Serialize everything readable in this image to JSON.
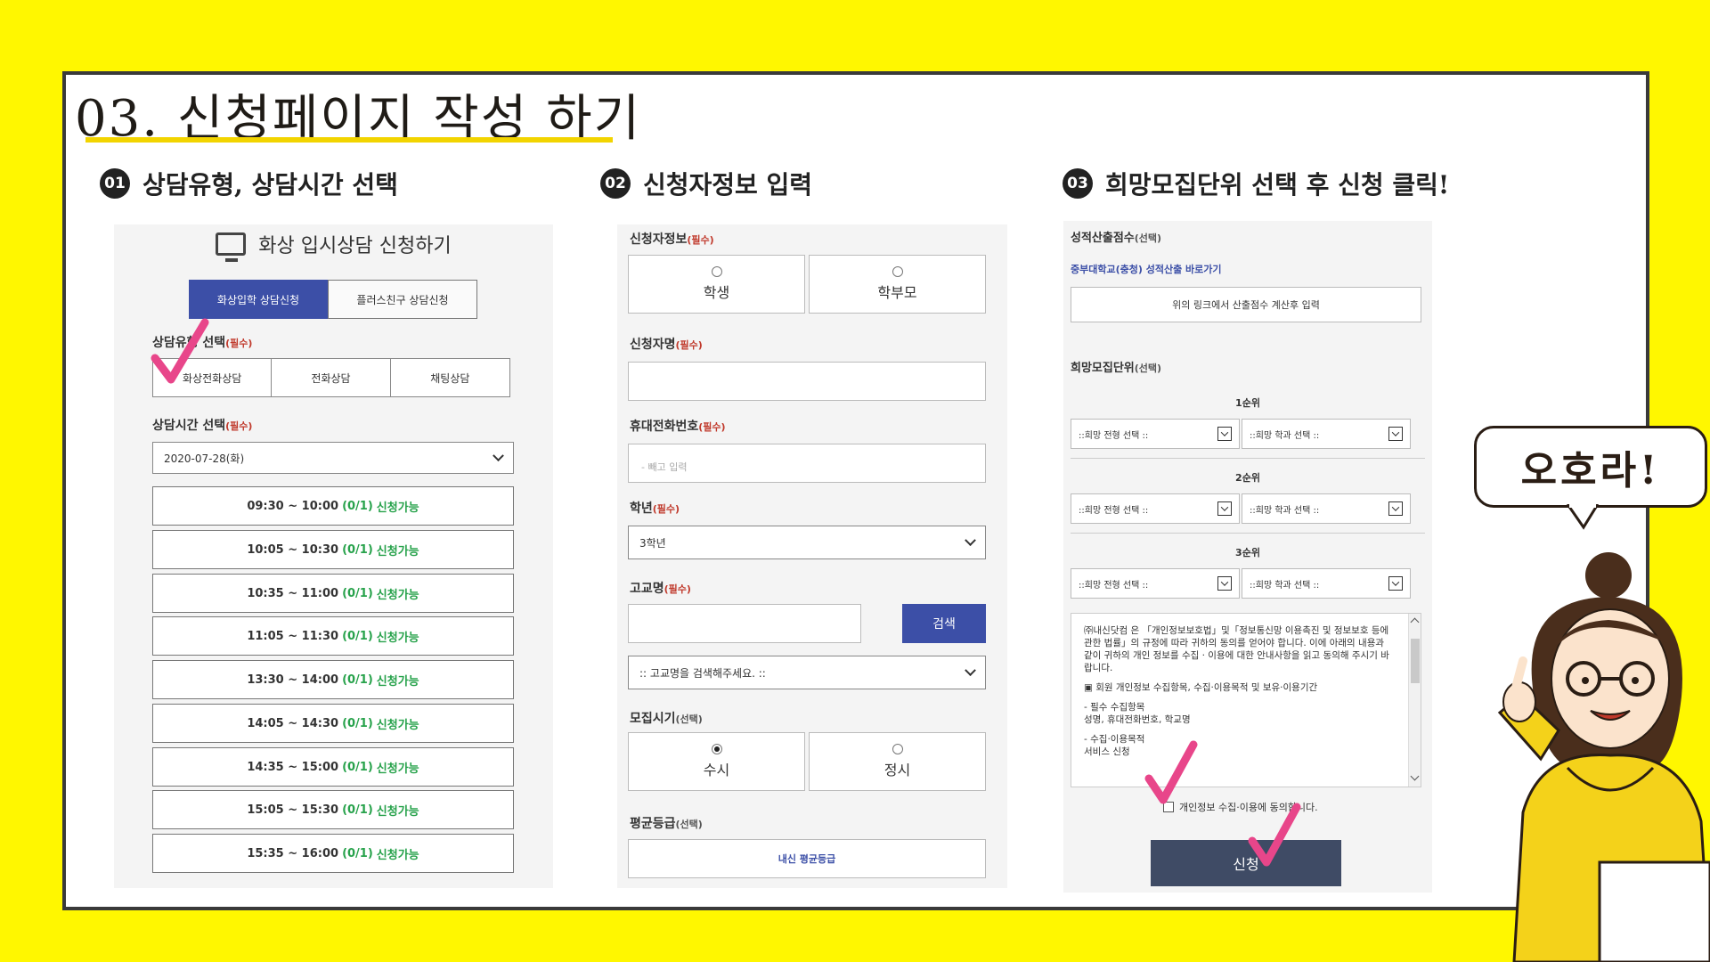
{
  "title": "03. 신청페이지 작성 하기",
  "steps": [
    {
      "num": "01",
      "label": "상담유형, 상담시간 선택"
    },
    {
      "num": "02",
      "label": "신청자정보 입력"
    },
    {
      "num": "03",
      "label": "희망모집단위 선택 후 신청 클릭!"
    }
  ],
  "panel1": {
    "header": "화상 입시상담 신청하기",
    "tabs": [
      "화상입학 상담신청",
      "플러스친구 상담신청"
    ],
    "type_label": "상담유형 선택",
    "required": "(필수)",
    "types": [
      "화상전화상담",
      "전화상담",
      "채팅상담"
    ],
    "time_label": "상담시간 선택",
    "date": "2020-07-28(화)",
    "slots": [
      {
        "time": "09:30 ~ 10:00",
        "count": "(0/1)",
        "status": "신청가능"
      },
      {
        "time": "10:05 ~ 10:30",
        "count": "(0/1)",
        "status": "신청가능"
      },
      {
        "time": "10:35 ~ 11:00",
        "count": "(0/1)",
        "status": "신청가능"
      },
      {
        "time": "11:05 ~ 11:30",
        "count": "(0/1)",
        "status": "신청가능"
      },
      {
        "time": "13:30 ~ 14:00",
        "count": "(0/1)",
        "status": "신청가능"
      },
      {
        "time": "14:05 ~ 14:30",
        "count": "(0/1)",
        "status": "신청가능"
      },
      {
        "time": "14:35 ~ 15:00",
        "count": "(0/1)",
        "status": "신청가능"
      },
      {
        "time": "15:05 ~ 15:30",
        "count": "(0/1)",
        "status": "신청가능"
      },
      {
        "time": "15:35 ~ 16:00",
        "count": "(0/1)",
        "status": "신청가능"
      }
    ]
  },
  "panel2": {
    "applicant_label": "신청자정보",
    "required": "(필수)",
    "optional": "(선택)",
    "applicant_options": [
      "학생",
      "학부모"
    ],
    "name_label": "신청자명",
    "phone_label": "휴대전화번호",
    "phone_placeholder": "- 빼고 입력",
    "grade_label": "학년",
    "grade_value": "3학년",
    "school_label": "고교명",
    "search_button": "검색",
    "school_select": ":: 고교명을 검색해주세요. ::",
    "period_label": "모집시기",
    "period_options": [
      "수시",
      "정시"
    ],
    "average_label": "평균등급",
    "average_button": "내신 평균등급"
  },
  "panel3": {
    "score_label": "성적산출점수",
    "optional": "(선택)",
    "score_link": "중부대학교(충청) 성적산출 바로가기",
    "score_hint": "위의 링크에서 산출점수 계산후 입력",
    "unit_label": "희망모집단위",
    "ranks": [
      "1순위",
      "2순위",
      "3순위"
    ],
    "type_select": "::희망 전형 선택 ::",
    "dept_select": "::희망 학과 선택 ::",
    "terms": [
      "㈜내신닷컴 은 「개인정보보호법」및「정보통신망 이용촉진 및 정보보호 등에 관한 법률」의 규정에 따라 귀하의 동의를 얻어야 합니다. 이에 아래의 내용과 같이 귀하의 개인 정보를 수집 · 이용에 대한 안내사항을 읽고 동의해 주시기 바랍니다.",
      "▣ 회원 개인정보 수집항목, 수집·이용목적 및 보유·이용기간",
      "- 필수 수집항목",
      "성명, 휴대전화번호, 학교명",
      "- 수집·이용목적",
      "서비스 신청"
    ],
    "consent": "개인정보 수집·이용에 동의합니다.",
    "submit": "신청"
  },
  "bubble": "오호라!",
  "colors": {
    "background": "#fff700",
    "primary_blue": "#3c4fa7",
    "available_green": "#27a24b",
    "check_pink": "#e8468a",
    "submit_navy": "#3f4b65"
  }
}
